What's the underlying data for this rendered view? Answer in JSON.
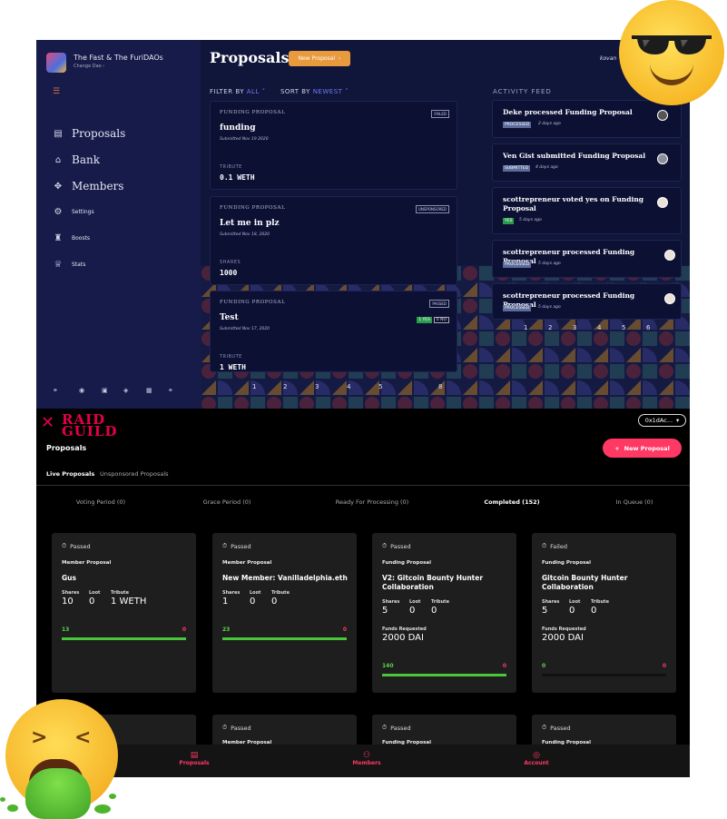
{
  "top": {
    "dao_name": "The Fast & The FuriDAOs",
    "change_dao": "Change Dao ›",
    "menu_icon": "☰",
    "nav": [
      {
        "label": "Proposals",
        "icon": "proposals-icon"
      },
      {
        "label": "Bank",
        "icon": "bank-icon"
      },
      {
        "label": "Members",
        "icon": "members-icon"
      },
      {
        "label": "Settings",
        "icon": "settings-icon"
      },
      {
        "label": "Boosts",
        "icon": "boosts-icon"
      },
      {
        "label": "Stats",
        "icon": "stats-icon"
      }
    ],
    "page_title": "Proposals",
    "new_proposal": "New Proposal",
    "network": "kovan",
    "filter_label": "FILTER BY",
    "filter_value": "ALL",
    "sort_label": "SORT BY",
    "sort_value": "NEWEST",
    "activity_feed": "ACTIVITY FEED",
    "proposals": [
      {
        "type": "FUNDING PROPOSAL",
        "title": "funding",
        "submitted": "Submitted Nov 19 2020",
        "badge": "FAILED",
        "key": "TRIBUTE",
        "value": "0.1 WETH"
      },
      {
        "type": "FUNDING PROPOSAL",
        "title": "Let me in plz",
        "submitted": "Submitted Nov 18, 2020",
        "badge": "UNSPONSORED",
        "key": "SHARES",
        "value": "1000"
      },
      {
        "type": "FUNDING PROPOSAL",
        "title": "Test",
        "submitted": "Submitted Nov 17, 2020",
        "badge": "PASSED",
        "key": "TRIBUTE",
        "value": "1 WETH",
        "yes": "1 YES",
        "no": "0 NO"
      }
    ],
    "pager_left": [
      "1",
      "2",
      "3",
      "4",
      "5",
      "8"
    ],
    "activity": [
      {
        "text": "Deke processed Funding Proposal",
        "tag": "PROCESSED",
        "when": "2 days ago"
      },
      {
        "text": "Ven Gist submitted Funding Proposal",
        "tag": "SUBMITTED",
        "when": "4 days ago"
      },
      {
        "text": "scottrepreneur voted yes on Funding Proposal",
        "tag": "YES",
        "when": "5 days ago"
      },
      {
        "text": "scottrepreneur processed Funding Proposal",
        "tag": "PROCESSED",
        "when": "5 days ago"
      },
      {
        "text": "scottrepreneur processed Funding Proposal",
        "tag": "PROCESSED",
        "when": "5 days ago"
      }
    ],
    "pager_right": [
      "1",
      "2",
      "3",
      "4",
      "5",
      "6"
    ],
    "colors": {
      "bg": "#10153a",
      "sidebar": "#161b4a",
      "accent": "#e89a3c",
      "link": "#6e7cf4"
    }
  },
  "bottom": {
    "logo_line1": "RAID",
    "logo_line2": "GUILD",
    "account": "0x1dAc...",
    "title": "Proposals",
    "new_proposal": "New Proposal",
    "tabs": [
      "Live Proposals",
      "Unsponsored Proposals"
    ],
    "periods": [
      "Voting Period (0)",
      "Grace Period (0)",
      "Ready For Processing (0)",
      "Completed (152)",
      "In Queue (0)"
    ],
    "cards": [
      {
        "status": "Passed",
        "type": "Member Proposal",
        "title": "Gus",
        "shares": "10",
        "loot": "0",
        "tribute": "1 WETH",
        "yes": "13",
        "no": "0",
        "yes_fraction": 1.0
      },
      {
        "status": "Passed",
        "type": "Member Proposal",
        "title": "New Member: Vanilladelphia.eth",
        "shares": "1",
        "loot": "0",
        "tribute": "0",
        "yes": "23",
        "no": "0",
        "yes_fraction": 1.0
      },
      {
        "status": "Passed",
        "type": "Funding Proposal",
        "title": "V2: Gitcoin Bounty Hunter Collaboration",
        "shares": "5",
        "loot": "0",
        "tribute": "0",
        "funds_label": "Funds Requested",
        "funds": "2000 DAI",
        "yes": "140",
        "no": "0",
        "yes_fraction": 1.0
      },
      {
        "status": "Failed",
        "type": "Funding Proposal",
        "title": "Gitcoin Bounty Hunter Collaboration",
        "shares": "5",
        "loot": "0",
        "tribute": "0",
        "funds_label": "Funds Requested",
        "funds": "2000 DAI",
        "yes": "0",
        "no": "0",
        "yes_fraction": 0
      }
    ],
    "lower_cards": [
      {
        "status": "Passed",
        "type": "Member Proposal"
      },
      {
        "status": "Passed",
        "type": "Funding Proposal"
      },
      {
        "status": "Passed",
        "type": "Funding Proposal"
      }
    ],
    "labels": {
      "shares": "Shares",
      "loot": "Loot",
      "tribute": "Tribute"
    },
    "bottom_nav": [
      {
        "label": "Proposals",
        "icon": "clipboard-icon"
      },
      {
        "label": "Members",
        "icon": "people-icon"
      },
      {
        "label": "Account",
        "icon": "account-icon"
      }
    ],
    "colors": {
      "accent": "#ff3864",
      "yes": "#59d64a",
      "card": "#1e1e1e"
    }
  },
  "emojis": [
    "cool-sunglasses-emoji",
    "vomiting-face-emoji"
  ]
}
